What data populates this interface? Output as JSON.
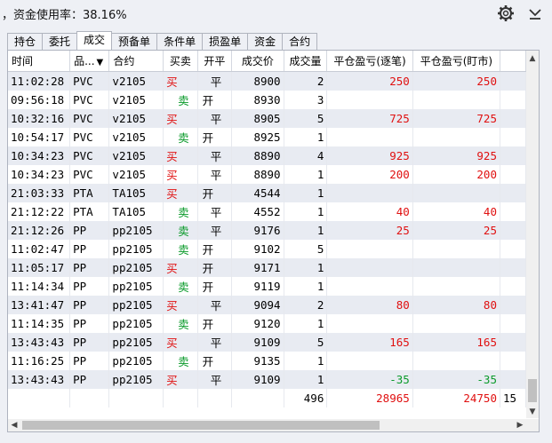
{
  "header": {
    "title": "，资金使用率：38.16%"
  },
  "tabs": [
    {
      "label": "持仓",
      "active": false
    },
    {
      "label": "委托",
      "active": false
    },
    {
      "label": "成交",
      "active": true
    },
    {
      "label": "预备单",
      "active": false
    },
    {
      "label": "条件单",
      "active": false
    },
    {
      "label": "损盈单",
      "active": false
    },
    {
      "label": "资金",
      "active": false
    },
    {
      "label": "合约",
      "active": false
    }
  ],
  "table": {
    "columns": [
      "时间",
      "品...",
      "合约",
      "买卖",
      "开平",
      "成交价",
      "成交量",
      "平仓盈亏(逐笔)",
      "平仓盈亏(盯市)"
    ],
    "rows": [
      {
        "time": "11:02:28",
        "product": "PVC",
        "contract": "v2105",
        "side": "买",
        "openclose": "平",
        "price": "8900",
        "volume": "2",
        "pnl_trade": "250",
        "pnl_mark": "250"
      },
      {
        "time": "09:56:18",
        "product": "PVC",
        "contract": "v2105",
        "side": "卖",
        "openclose": "开",
        "price": "8930",
        "volume": "3",
        "pnl_trade": "",
        "pnl_mark": ""
      },
      {
        "time": "10:32:16",
        "product": "PVC",
        "contract": "v2105",
        "side": "买",
        "openclose": "平",
        "price": "8905",
        "volume": "5",
        "pnl_trade": "725",
        "pnl_mark": "725"
      },
      {
        "time": "10:54:17",
        "product": "PVC",
        "contract": "v2105",
        "side": "卖",
        "openclose": "开",
        "price": "8925",
        "volume": "1",
        "pnl_trade": "",
        "pnl_mark": ""
      },
      {
        "time": "10:34:23",
        "product": "PVC",
        "contract": "v2105",
        "side": "买",
        "openclose": "平",
        "price": "8890",
        "volume": "4",
        "pnl_trade": "925",
        "pnl_mark": "925"
      },
      {
        "time": "10:34:23",
        "product": "PVC",
        "contract": "v2105",
        "side": "买",
        "openclose": "平",
        "price": "8890",
        "volume": "1",
        "pnl_trade": "200",
        "pnl_mark": "200"
      },
      {
        "time": "21:03:33",
        "product": "PTA",
        "contract": "TA105",
        "side": "买",
        "openclose": "开",
        "price": "4544",
        "volume": "1",
        "pnl_trade": "",
        "pnl_mark": ""
      },
      {
        "time": "21:12:22",
        "product": "PTA",
        "contract": "TA105",
        "side": "卖",
        "openclose": "平",
        "price": "4552",
        "volume": "1",
        "pnl_trade": "40",
        "pnl_mark": "40"
      },
      {
        "time": "21:12:26",
        "product": "PP",
        "contract": "pp2105",
        "side": "卖",
        "openclose": "平",
        "price": "9176",
        "volume": "1",
        "pnl_trade": "25",
        "pnl_mark": "25"
      },
      {
        "time": "11:02:47",
        "product": "PP",
        "contract": "pp2105",
        "side": "卖",
        "openclose": "开",
        "price": "9102",
        "volume": "5",
        "pnl_trade": "",
        "pnl_mark": ""
      },
      {
        "time": "11:05:17",
        "product": "PP",
        "contract": "pp2105",
        "side": "买",
        "openclose": "开",
        "price": "9171",
        "volume": "1",
        "pnl_trade": "",
        "pnl_mark": ""
      },
      {
        "time": "11:14:34",
        "product": "PP",
        "contract": "pp2105",
        "side": "卖",
        "openclose": "开",
        "price": "9119",
        "volume": "1",
        "pnl_trade": "",
        "pnl_mark": ""
      },
      {
        "time": "13:41:47",
        "product": "PP",
        "contract": "pp2105",
        "side": "买",
        "openclose": "平",
        "price": "9094",
        "volume": "2",
        "pnl_trade": "80",
        "pnl_mark": "80"
      },
      {
        "time": "11:14:35",
        "product": "PP",
        "contract": "pp2105",
        "side": "卖",
        "openclose": "开",
        "price": "9120",
        "volume": "1",
        "pnl_trade": "",
        "pnl_mark": ""
      },
      {
        "time": "13:43:43",
        "product": "PP",
        "contract": "pp2105",
        "side": "买",
        "openclose": "平",
        "price": "9109",
        "volume": "5",
        "pnl_trade": "165",
        "pnl_mark": "165"
      },
      {
        "time": "11:16:25",
        "product": "PP",
        "contract": "pp2105",
        "side": "卖",
        "openclose": "开",
        "price": "9135",
        "volume": "1",
        "pnl_trade": "",
        "pnl_mark": ""
      },
      {
        "time": "13:43:43",
        "product": "PP",
        "contract": "pp2105",
        "side": "买",
        "openclose": "平",
        "price": "9109",
        "volume": "1",
        "pnl_trade": "-35",
        "pnl_mark": "-35"
      }
    ],
    "totals": {
      "volume": "496",
      "pnl_trade": "28965",
      "pnl_mark": "24750",
      "overflow": "15"
    }
  },
  "icons": {
    "settings": "gear-icon",
    "collapse": "chevron-down-icon",
    "sort": "sort-down-icon"
  },
  "colors": {
    "buy": "#e01010",
    "sell": "#0a9a2a",
    "row_alt": "#e8ebf2"
  }
}
